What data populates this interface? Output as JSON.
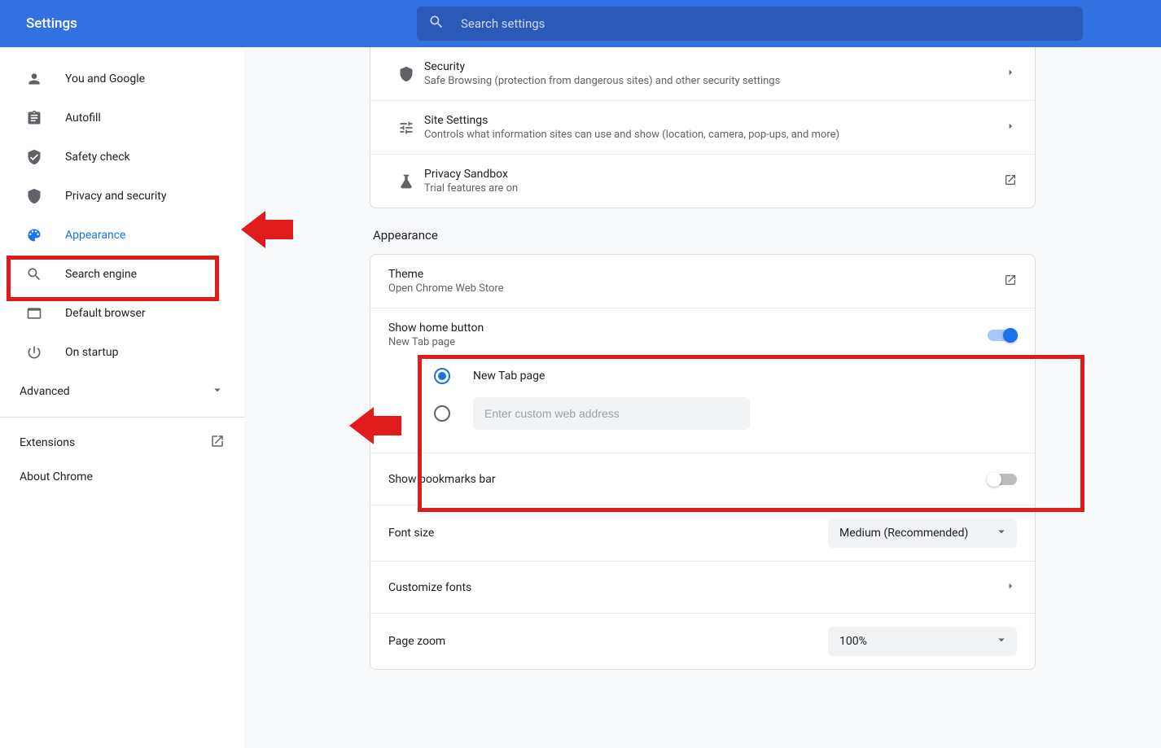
{
  "header": {
    "title": "Settings"
  },
  "search": {
    "placeholder": "Search settings"
  },
  "sidebar": {
    "items": [
      {
        "label": "You and Google"
      },
      {
        "label": "Autofill"
      },
      {
        "label": "Safety check"
      },
      {
        "label": "Privacy and security"
      },
      {
        "label": "Appearance"
      },
      {
        "label": "Search engine"
      },
      {
        "label": "Default browser"
      },
      {
        "label": "On startup"
      }
    ],
    "advanced": "Advanced",
    "extensions": "Extensions",
    "about": "About Chrome"
  },
  "privacy_card": [
    {
      "title": "Security",
      "sub": "Safe Browsing (protection from dangerous sites) and other security settings"
    },
    {
      "title": "Site Settings",
      "sub": "Controls what information sites can use and show (location, camera, pop-ups, and more)"
    },
    {
      "title": "Privacy Sandbox",
      "sub": "Trial features are on"
    }
  ],
  "appearance": {
    "header": "Appearance",
    "theme": {
      "title": "Theme",
      "sub": "Open Chrome Web Store"
    },
    "home": {
      "title": "Show home button",
      "sub": "New Tab page",
      "opt1": "New Tab page",
      "custom_placeholder": "Enter custom web address"
    },
    "bookmarks": {
      "title": "Show bookmarks bar"
    },
    "fontsize": {
      "title": "Font size",
      "value": "Medium (Recommended)"
    },
    "customfonts": {
      "title": "Customize fonts"
    },
    "zoom": {
      "title": "Page zoom",
      "value": "100%"
    }
  }
}
